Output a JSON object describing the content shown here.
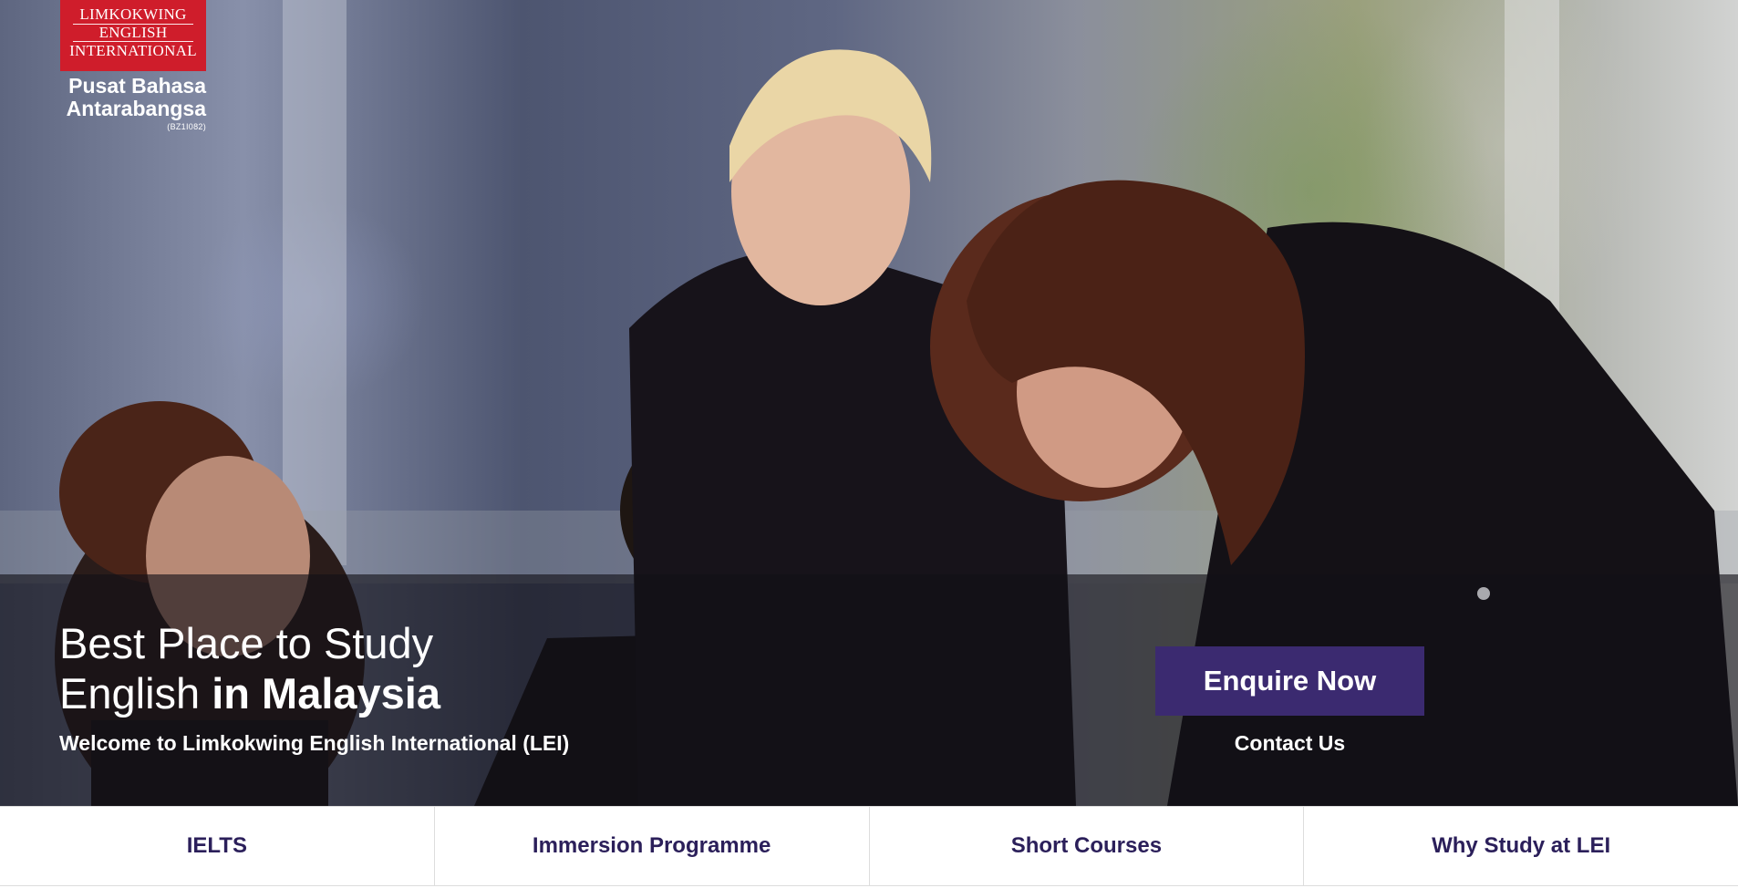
{
  "logo": {
    "line1": "LIMKOKWING",
    "line2": "ENGLISH",
    "line3": "INTERNATIONAL",
    "subtitle_line1": "Pusat Bahasa",
    "subtitle_line2": "Antarabangsa",
    "registration": "(BZ1I082)"
  },
  "hero": {
    "headline_line1": "Best Place to Study",
    "headline_line2_regular": "English ",
    "headline_line2_bold": "in Malaysia",
    "welcome": "Welcome to Limkokwing English International (LEI)",
    "enquire_label": "Enquire Now",
    "contact_label": "Contact Us"
  },
  "nav": {
    "items": [
      {
        "label": "IELTS"
      },
      {
        "label": "Immersion Programme"
      },
      {
        "label": "Short Courses"
      },
      {
        "label": "Why Study at LEI"
      }
    ]
  },
  "colors": {
    "brand_red": "#cf1d2b",
    "accent_purple": "#3b2a70",
    "nav_text": "#2b1f5a"
  }
}
